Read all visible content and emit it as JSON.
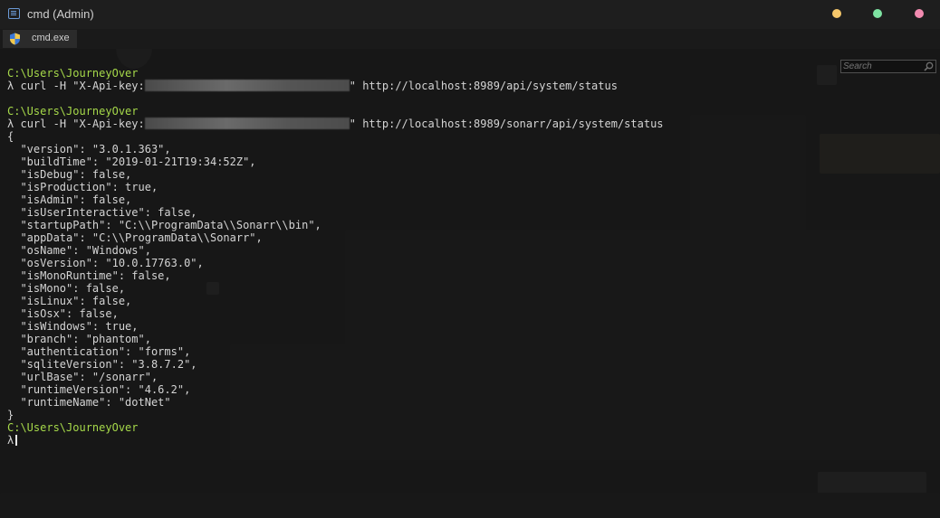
{
  "window": {
    "title": "cmd (Admin)",
    "controls": {
      "minimize_color": "#f6c76a",
      "maximize_color": "#7ee3a2",
      "close_color": "#f28bb0"
    }
  },
  "tab": {
    "label": "cmd.exe",
    "icon": "uac-shield-icon"
  },
  "search": {
    "placeholder": "Search",
    "icon": "search-icon"
  },
  "colors": {
    "background": "#1c1c1c",
    "text": "#d4d4d4",
    "prompt_path": "#a6d94a"
  },
  "console": {
    "prompt_symbol": "λ",
    "path": "C:\\Users\\JourneyOver",
    "cmd1": {
      "prefix": "curl -H \"X-Api-key:",
      "suffix": "\" http://localhost:8989/api/system/status"
    },
    "cmd2": {
      "prefix": "curl -H \"X-Api-key:",
      "suffix": "\" http://localhost:8989/sonarr/api/system/status"
    },
    "json_output": [
      "{",
      "  \"version\": \"3.0.1.363\",",
      "  \"buildTime\": \"2019-01-21T19:34:52Z\",",
      "  \"isDebug\": false,",
      "  \"isProduction\": true,",
      "  \"isAdmin\": false,",
      "  \"isUserInteractive\": false,",
      "  \"startupPath\": \"C:\\\\ProgramData\\\\Sonarr\\\\bin\",",
      "  \"appData\": \"C:\\\\ProgramData\\\\Sonarr\",",
      "  \"osName\": \"Windows\",",
      "  \"osVersion\": \"10.0.17763.0\",",
      "  \"isMonoRuntime\": false,",
      "  \"isMono\": false,",
      "  \"isLinux\": false,",
      "  \"isOsx\": false,",
      "  \"isWindows\": true,",
      "  \"branch\": \"phantom\",",
      "  \"authentication\": \"forms\",",
      "  \"sqliteVersion\": \"3.8.7.2\",",
      "  \"urlBase\": \"/sonarr\",",
      "  \"runtimeVersion\": \"4.6.2\",",
      "  \"runtimeName\": \"dotNet\"",
      "}"
    ]
  }
}
